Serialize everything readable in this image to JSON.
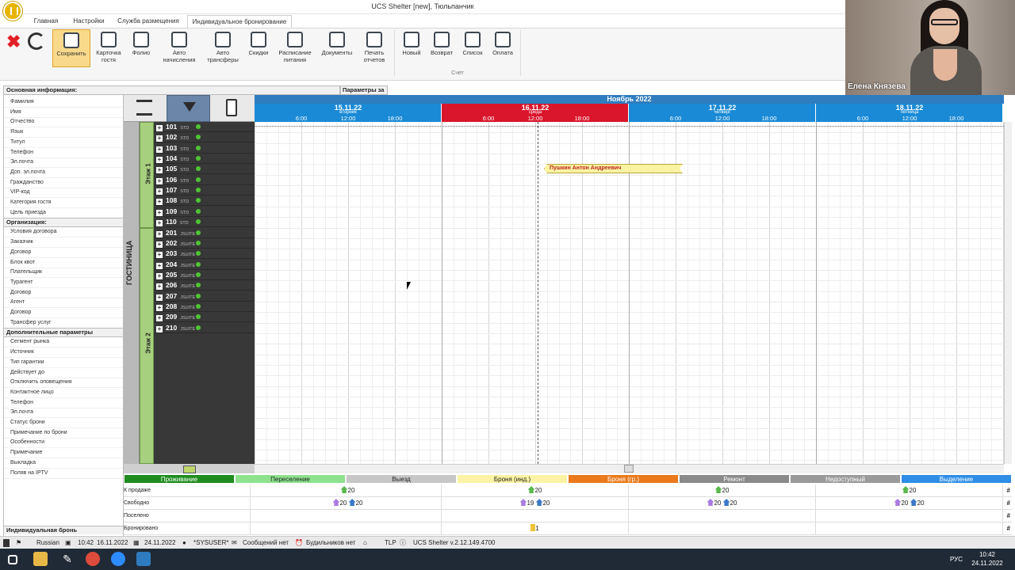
{
  "window": {
    "title": "UCS Shelter [new], Тюльпанчик"
  },
  "tabs": [
    {
      "label": "Главная"
    },
    {
      "label": "Настройки"
    },
    {
      "label": "Служба размещения"
    },
    {
      "label": "Индивидуальное бронирование"
    }
  ],
  "ribbon": {
    "save": "Сохранить",
    "guest_card": "Карточка гостя",
    "folio": "Фолио",
    "auto_charges": "Авто начисления",
    "auto_transfers": "Авто трансферы",
    "discounts": "Скидки",
    "meal_schedule": "Расписание питания",
    "documents": "Документы",
    "print_reports": "Печать отчетов",
    "new": "Новый",
    "return": "Возврат",
    "list": "Список",
    "payment": "Оплата",
    "account_group": "Счет"
  },
  "left_panel": {
    "main_header": "Основная информация:",
    "params_header": "Параметры за",
    "main_fields": [
      "Фамилия",
      "Имя",
      "Отчество",
      "Язык",
      "Титул",
      "Телефон",
      "Эл.почта",
      "Доп. эл.почта",
      "Гражданство",
      "VIP-код",
      "Категория гостя",
      "Цель приезда"
    ],
    "org_header": "Организация:",
    "org_fields": [
      "Условия договора",
      "Заказчик",
      "Договор",
      "Блок квот",
      "Плательщик",
      "Турагент",
      "Договор",
      "Агент",
      "Договор",
      "Трансфер услуг"
    ],
    "extra_header": "Дополнительные параметры",
    "extra_fields": [
      "Сегмент рынка",
      "Источник",
      "Тип гарантии",
      "Действует до",
      "Отключить оповещения",
      "Контактное лицо",
      "Телефон",
      "Эл.почта",
      "Статус брони",
      "Примечание по брони",
      "Особенности",
      "Примечание",
      "Выкладка",
      "Поляв на IPTV"
    ],
    "bottom_tab": "Индивидуальная бронь"
  },
  "hotel": {
    "name": "ГОСТИНИЦА",
    "floors": [
      {
        "label": "Этаж 1"
      },
      {
        "label": "Этаж 2"
      }
    ]
  },
  "rooms": [
    {
      "num": "101",
      "type": "STD"
    },
    {
      "num": "102",
      "type": "STD"
    },
    {
      "num": "103",
      "type": "STD"
    },
    {
      "num": "104",
      "type": "STD"
    },
    {
      "num": "105",
      "type": "STD"
    },
    {
      "num": "106",
      "type": "STD"
    },
    {
      "num": "107",
      "type": "STD"
    },
    {
      "num": "108",
      "type": "STD"
    },
    {
      "num": "109",
      "type": "STD"
    },
    {
      "num": "110",
      "type": "STD"
    },
    {
      "num": "201",
      "type": "JSUITE"
    },
    {
      "num": "202",
      "type": "JSUITE"
    },
    {
      "num": "203",
      "type": "JSUITE"
    },
    {
      "num": "204",
      "type": "JSUITE"
    },
    {
      "num": "205",
      "type": "JSUITE"
    },
    {
      "num": "206",
      "type": "JSUITE"
    },
    {
      "num": "207",
      "type": "JSUITE"
    },
    {
      "num": "208",
      "type": "JSUITE"
    },
    {
      "num": "209",
      "type": "JSUITE"
    },
    {
      "num": "210",
      "type": "JSUITE"
    }
  ],
  "calendar": {
    "month": "Ноябрь 2022",
    "days": [
      {
        "date": "15.11.22",
        "weekday": "вторник",
        "h1": "6:00",
        "h2": "12:00",
        "h3": "18:00"
      },
      {
        "date": "16.11.22",
        "weekday": "среда",
        "h1": "6:00",
        "h2": "12:00",
        "h3": "18:00"
      },
      {
        "date": "17.11.22",
        "weekday": "четверг",
        "h1": "6:00",
        "h2": "12:00",
        "h3": "18:00"
      },
      {
        "date": "18.11.22",
        "weekday": "пятница",
        "h1": "6:00",
        "h2": "12:00",
        "h3": "18:00"
      }
    ]
  },
  "booking": {
    "guest": "Пушкин Антон Андреевич"
  },
  "legend": [
    {
      "label": "Проживание",
      "color": "#1e8c1e",
      "text": "#ffffff"
    },
    {
      "label": "Переселение",
      "color": "#8ee28e",
      "text": "#222222"
    },
    {
      "label": "Выезд",
      "color": "#c7c7c7",
      "text": "#222222"
    },
    {
      "label": "Броня (инд.)",
      "color": "#fbf3a3",
      "text": "#222222"
    },
    {
      "label": "Броня (гр.)",
      "color": "#ea7a1c",
      "text": "#ffffff"
    },
    {
      "label": "Ремонт",
      "color": "#8a8a8a",
      "text": "#ffffff"
    },
    {
      "label": "Недоступный",
      "color": "#9a9a9a",
      "text": "#ffffff"
    },
    {
      "label": "Выделение",
      "color": "#2f8ee6",
      "text": "#ffffff"
    }
  ],
  "stats": {
    "rows": [
      "К продаже",
      "Свободно",
      "Поселено",
      "Бронировано"
    ],
    "for_sale": [
      "20",
      "20",
      "20",
      "20"
    ],
    "free_a": [
      "20",
      "19",
      "20",
      "20"
    ],
    "free_b": [
      "20",
      "20",
      "20",
      "20"
    ],
    "booked_day2": "1",
    "hash": "#"
  },
  "statusbar": {
    "lang": "Russian",
    "time": "10:42",
    "date1": "16.11.2022",
    "date2": "24.11.2022",
    "user": "*SYSUSER*",
    "messages": "Сообщений нет",
    "alarms": "Будильников нет",
    "tlp": "TLP",
    "version": "UCS Shelter v.2.12.149.4700"
  },
  "taskbar": {
    "lang": "РУС",
    "time": "10:42",
    "date": "24.11.2022"
  },
  "video": {
    "name": "Елена Князева"
  }
}
